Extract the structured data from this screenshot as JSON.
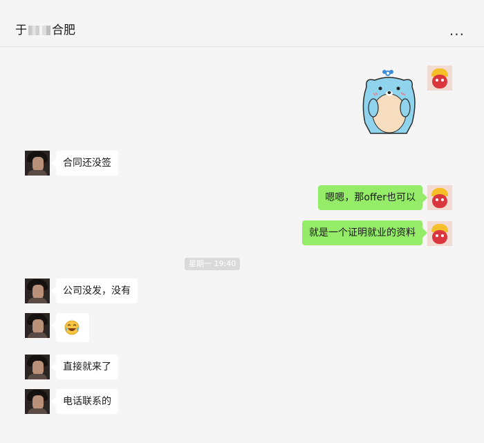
{
  "header": {
    "title_prefix": "于",
    "title_suffix": "合肥",
    "more_label": "..."
  },
  "messages": {
    "m1": {
      "text": "合同还没签"
    },
    "m2": {
      "text": "嗯嗯，那offer也可以"
    },
    "m3": {
      "text": "就是一个证明就业的资料"
    },
    "m4": {
      "text": "公司没发，没有"
    },
    "m6": {
      "text": "直接就来了"
    },
    "m7": {
      "text": "电话联系的"
    }
  },
  "timestamp": "星期一 19:40",
  "colors": {
    "incoming_bubble": "#ffffff",
    "outgoing_bubble": "#95ec69",
    "background": "#f5f5f5"
  },
  "icons": {
    "sticker": "blue-bear-sticker",
    "emoji": "crying-laughing-emoji-icon"
  }
}
